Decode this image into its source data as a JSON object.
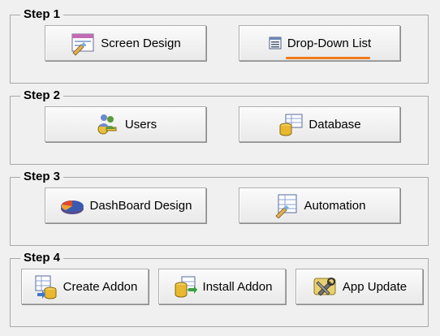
{
  "steps": [
    {
      "title": "Step 1",
      "buttons": [
        {
          "label": "Screen Design",
          "icon": "screen-design-icon"
        },
        {
          "label": "Drop-Down List",
          "icon": "drop-down-list-icon"
        }
      ]
    },
    {
      "title": "Step 2",
      "buttons": [
        {
          "label": "Users",
          "icon": "users-keys-icon"
        },
        {
          "label": "Database",
          "icon": "database-icon"
        }
      ]
    },
    {
      "title": "Step 3",
      "buttons": [
        {
          "label": "DashBoard Design",
          "icon": "pie-chart-icon"
        },
        {
          "label": "Automation",
          "icon": "automation-icon"
        }
      ]
    },
    {
      "title": "Step 4",
      "buttons": [
        {
          "label": "Create Addon",
          "icon": "create-addon-icon"
        },
        {
          "label": "Install Addon",
          "icon": "install-addon-icon"
        },
        {
          "label": "App Update",
          "icon": "app-update-icon"
        }
      ]
    }
  ],
  "colors": {
    "background": "#f0f0f0",
    "highlight_underline": "#f07a1c"
  }
}
